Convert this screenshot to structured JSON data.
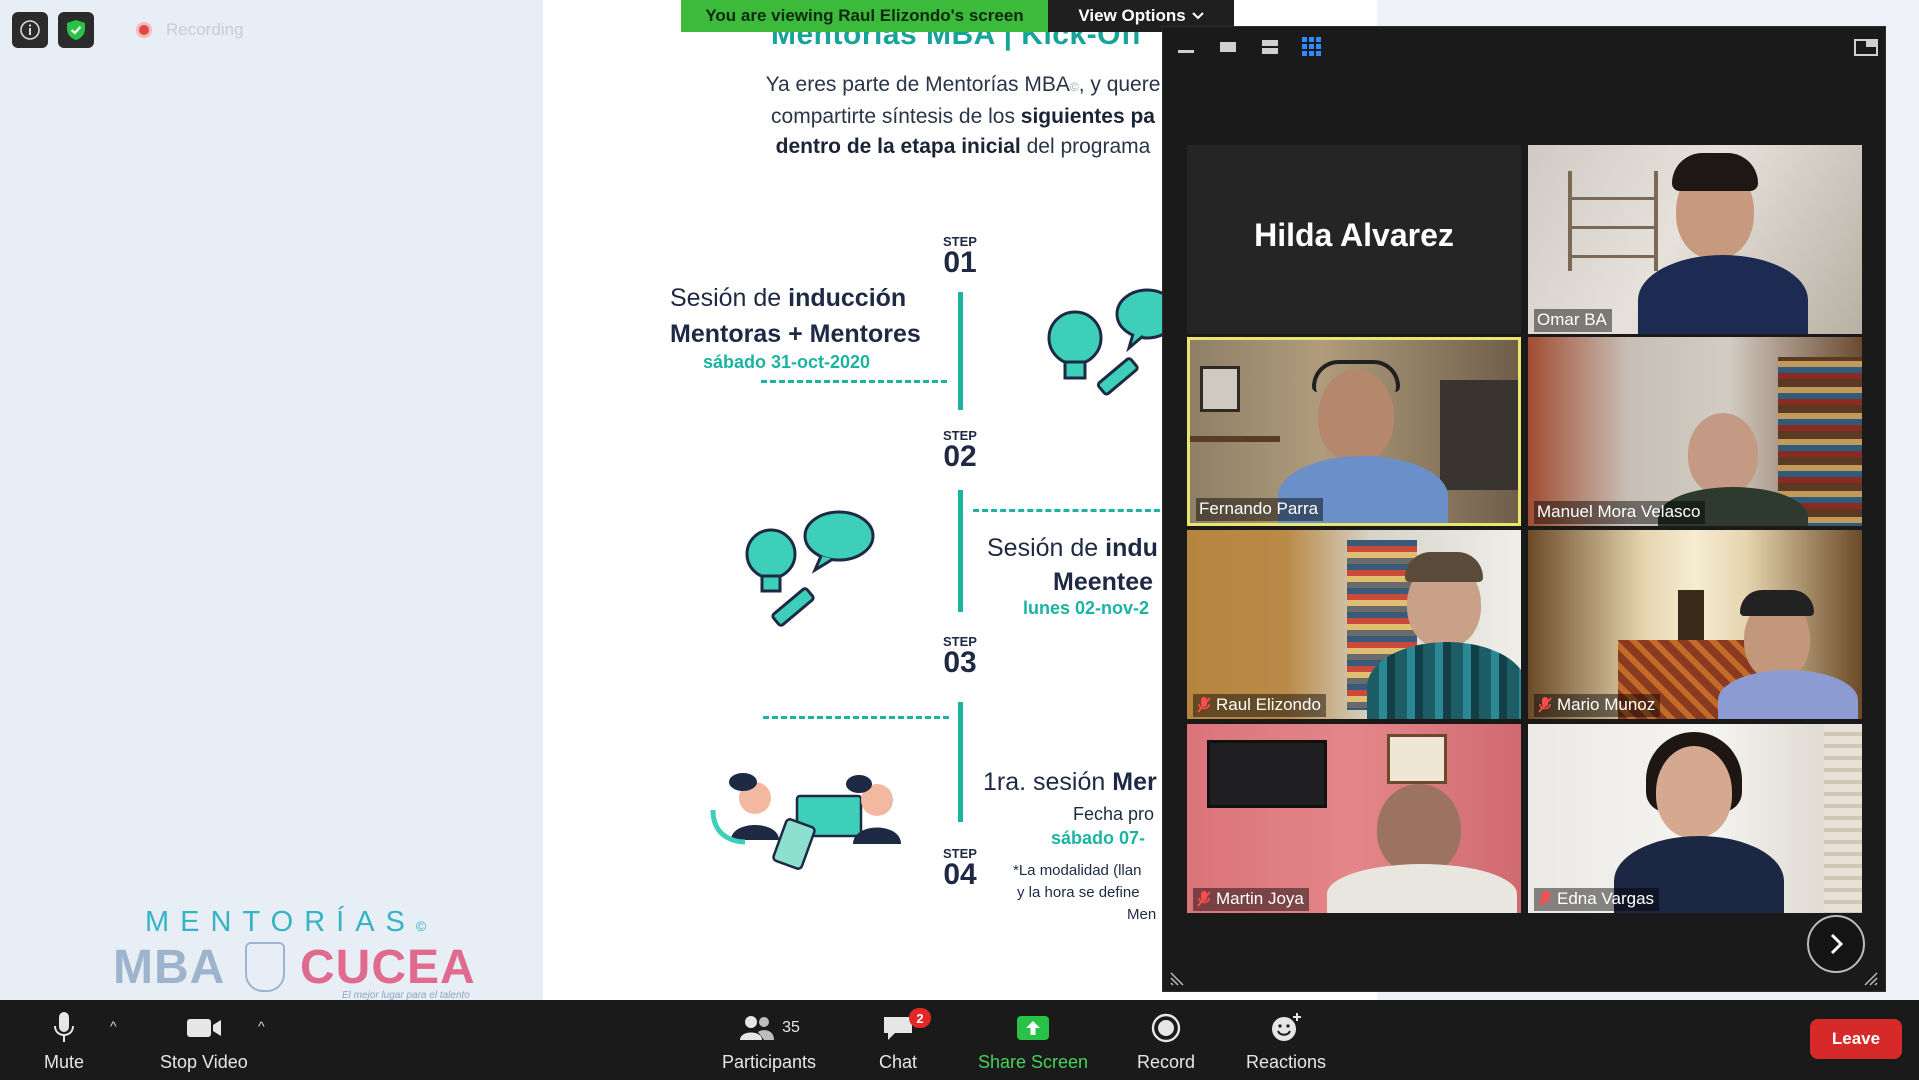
{
  "status": {
    "recording_label": "Recording"
  },
  "share": {
    "banner": "You are viewing Raul Elizondo's screen",
    "view_options": "View Options"
  },
  "slide": {
    "title": "Mentorías MBA | Kick-Off",
    "intro_1a": "Ya eres parte de Mentorías MBA",
    "intro_1b": ", y quere",
    "intro_2a": "compartirte síntesis de los ",
    "intro_2b": "siguientes pa",
    "intro_3a": "dentro de la etapa inicial",
    "intro_3b": " del programa",
    "step_word": "STEP",
    "steps": [
      "01",
      "02",
      "03",
      "04"
    ],
    "s1_line1a": "Sesión de ",
    "s1_line1b": "inducción",
    "s1_line2": "Mentoras + Mentores",
    "s1_date": "sábado 31-oct-2020",
    "s2_line1a": "Sesión de ",
    "s2_line1b": "indu",
    "s2_line2": "Meentee",
    "s2_date": "lunes 02-nov-2",
    "s3_line1a": "1ra. sesión ",
    "s3_line1b": "Mer",
    "s3_line2": "Fecha pro",
    "s3_date": "sábado 07-",
    "s3_note1": "*La modalidad (llan",
    "s3_note2": "y la hora se define",
    "s3_note3": "Men"
  },
  "logo": {
    "top": "MENTORÍAS",
    "copyright": "©",
    "mba": "MBA",
    "cucea": "CUCEA",
    "tagline": "El mejor lugar para el talento"
  },
  "gallery": {
    "participants": [
      {
        "name": "Hilda Alvarez",
        "video": false,
        "muted": false
      },
      {
        "name": "Omar BA",
        "video": true,
        "muted": false
      },
      {
        "name": "Fernando Parra",
        "video": true,
        "muted": false,
        "active": true
      },
      {
        "name": "Manuel Mora Velasco",
        "video": true,
        "muted": false
      },
      {
        "name": "Raul Elizondo",
        "video": true,
        "muted": true
      },
      {
        "name": "Mario Munoz",
        "video": true,
        "muted": true
      },
      {
        "name": "Martin Joya",
        "video": true,
        "muted": true
      },
      {
        "name": "Edna Vargas",
        "video": true,
        "muted": true
      }
    ]
  },
  "toolbar": {
    "mute": "Mute",
    "stop_video": "Stop Video",
    "participants": "Participants",
    "participants_count": "35",
    "chat": "Chat",
    "chat_badge": "2",
    "share_screen": "Share Screen",
    "record": "Record",
    "reactions": "Reactions",
    "leave": "Leave"
  },
  "colors": {
    "accent_teal": "#1db3a2",
    "share_green": "#3bba3b",
    "leave_red": "#d62a2a",
    "active_speaker": "#e8e66c"
  }
}
